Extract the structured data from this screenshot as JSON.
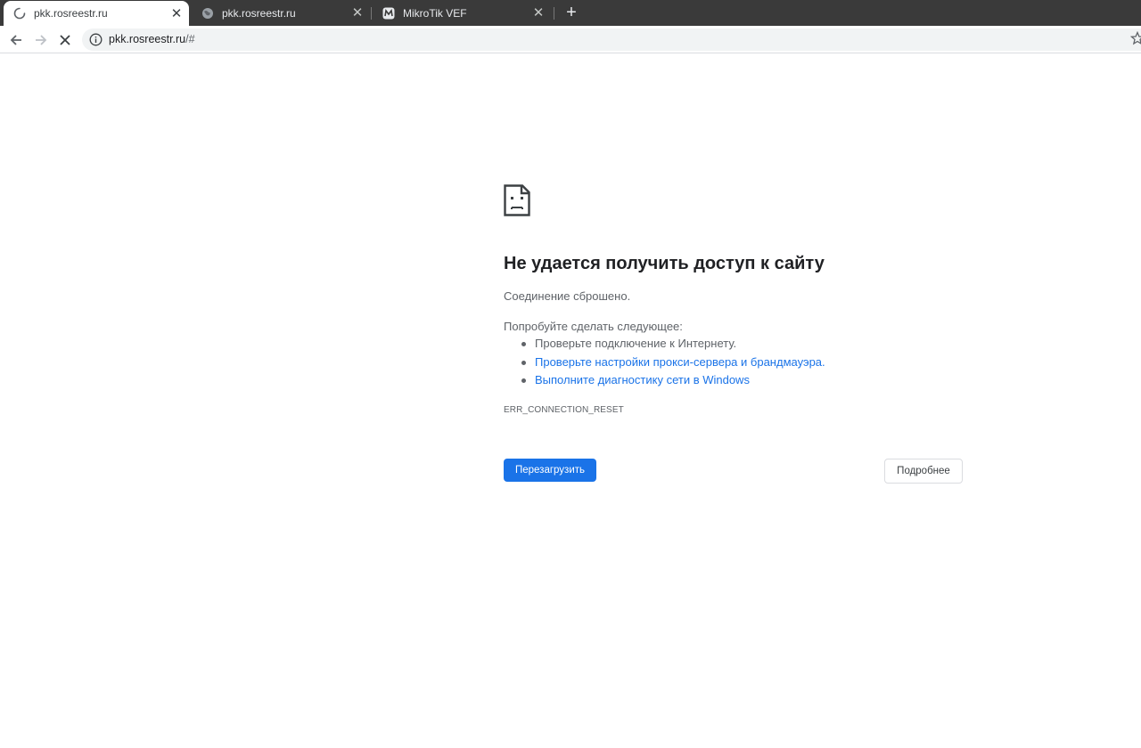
{
  "tabs": [
    {
      "title": "pkk.rosreestr.ru",
      "icon": "loading-spinner-icon",
      "active": true
    },
    {
      "title": "pkk.rosreestr.ru",
      "icon": "globe-icon",
      "active": false
    },
    {
      "title": "MikroTik VEF",
      "icon": "mikrotik-logo-icon",
      "active": false
    }
  ],
  "newtab_label": "+",
  "address_bar": {
    "host": "pkk.rosreestr.ru",
    "path": "/#"
  },
  "error_page": {
    "title": "Не удается получить доступ к сайту",
    "description": "Соединение сброшено.",
    "try_heading": "Попробуйте сделать следующее:",
    "suggestions": [
      {
        "text": "Проверьте подключение к Интернету.",
        "is_link": false
      },
      {
        "text": "Проверьте настройки прокси-сервера и брандмауэра.",
        "is_link": true
      },
      {
        "text": "Выполните диагностику сети в Windows",
        "is_link": true
      }
    ],
    "error_code": "ERR_CONNECTION_RESET",
    "reload_button": "Перезагрузить",
    "details_button": "Подробнее"
  },
  "colors": {
    "accent": "#1a73e8",
    "tabstrip_bg": "#3a3a3a",
    "text_secondary": "#5f6368"
  }
}
